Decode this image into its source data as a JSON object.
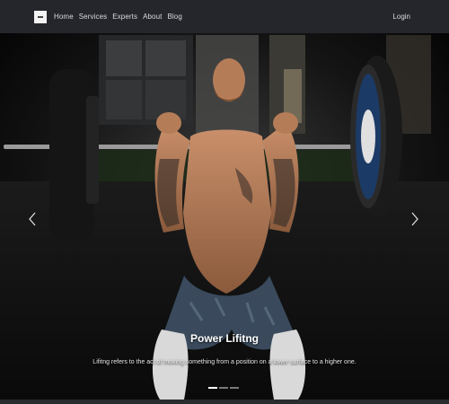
{
  "navbar": {
    "links": [
      "Home",
      "Services",
      "Experts",
      "About",
      "Blog"
    ],
    "login_label": "Login"
  },
  "carousel": {
    "slide": {
      "title": "Power Lifitng",
      "text": "Lifitng refers to the act of moving something from a position on a lower surface to a higher one."
    },
    "indicator_count": 3,
    "active_index": 0,
    "icons": {
      "prev": "chevron-left-icon",
      "next": "chevron-right-icon"
    }
  },
  "colors": {
    "navbar_bg": "#24262b",
    "nav_text": "#d9dadc",
    "page_bg": "#1f2125"
  }
}
